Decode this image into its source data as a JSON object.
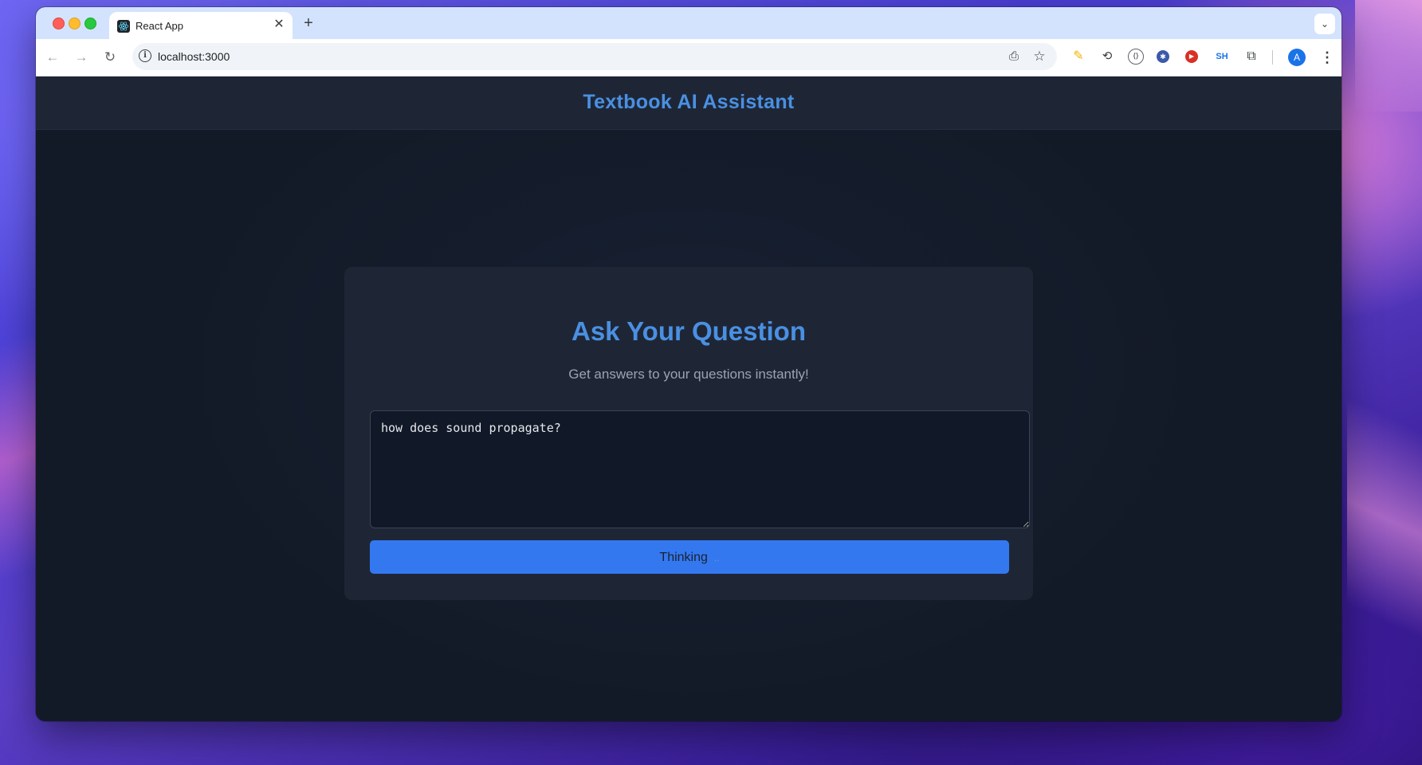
{
  "browser": {
    "tab_title": "React App",
    "tab_close": "✕",
    "new_tab": "+",
    "tab_search": "⌄",
    "url": "localhost:3000",
    "icons": {
      "back": "←",
      "forward": "→",
      "reload": "↻",
      "site_info": "i",
      "cast": "⎙",
      "bookmark": "☆",
      "ext_highlighter": "✎",
      "ext_sync": "⟲",
      "ext_code": "⟨⟩",
      "ext_blue": "✱",
      "ext_play": "▶",
      "ext_sh": "SH",
      "extensions": "⧉",
      "menu": "⋮"
    },
    "profile_initial": "A"
  },
  "app": {
    "header_title": "Textbook AI Assistant",
    "card": {
      "title": "Ask Your Question",
      "subtitle": "Get answers to your questions instantly!",
      "question_value": "how does sound propagate?",
      "button_label": "Thinking",
      "button_dots": ".."
    }
  },
  "colors": {
    "accent": "#4a90e2",
    "button": "#3478f0",
    "page_bg": "#131a27",
    "card_bg": "#1e2636"
  }
}
